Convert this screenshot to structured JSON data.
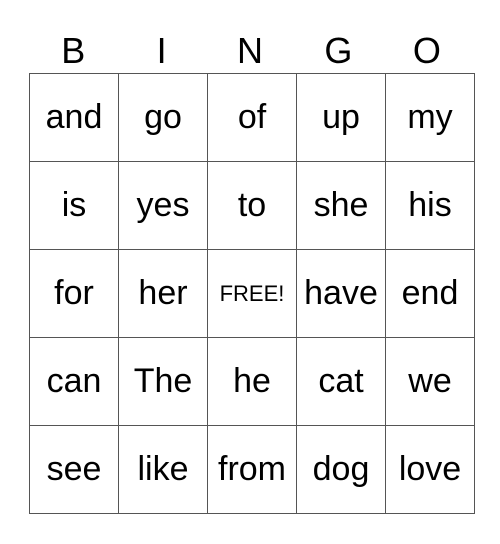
{
  "header": [
    "B",
    "I",
    "N",
    "G",
    "O"
  ],
  "cells": [
    [
      "and",
      "go",
      "of",
      "up",
      "my"
    ],
    [
      "is",
      "yes",
      "to",
      "she",
      "his"
    ],
    [
      "for",
      "her",
      "FREE!",
      "have",
      "end"
    ],
    [
      "can",
      "The",
      "he",
      "cat",
      "we"
    ],
    [
      "see",
      "like",
      "from",
      "dog",
      "love"
    ]
  ]
}
